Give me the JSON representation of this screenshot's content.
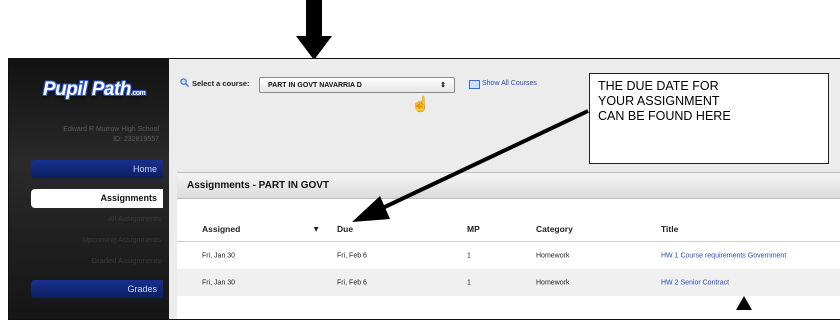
{
  "sidebar": {
    "logo_text": "Pupil Path",
    "logo_suffix": ".com",
    "school_name": "Edward R Murrow High School",
    "school_id": "ID: 232819557",
    "nav": {
      "home": "Home",
      "assignments": "Assignments",
      "all_assignments": "All Assignments",
      "upcoming_assignments": "Upcoming Assignments",
      "graded_assignments": "Graded Assignments",
      "grades": "Grades"
    }
  },
  "course_selector": {
    "label": "Select a course:",
    "selected": "PART IN GOVT NAVARRIA D",
    "show_all": "Show All Courses"
  },
  "panel": {
    "title": "Assignments - PART IN GOVT",
    "columns": {
      "assigned": "Assigned",
      "due": "Due",
      "mp": "MP",
      "category": "Category",
      "title": "Title"
    },
    "rows": [
      {
        "assigned": "Fri, Jan 30",
        "due": "Fri, Feb 6",
        "mp": "1",
        "category": "Homework",
        "title": "HW 1 Course requirements Government"
      },
      {
        "assigned": "Fri, Jan 30",
        "due": "Fri, Feb 6",
        "mp": "1",
        "category": "Homework",
        "title": "HW 2 Senior Contract"
      }
    ]
  },
  "annotation": {
    "lines": [
      "THE DUE DATE FOR",
      "YOUR ASSIGNMENT",
      "CAN BE FOUND HERE"
    ]
  },
  "colors": {
    "nav_blue": "#16318e",
    "link_blue": "#2a4bb0",
    "sidebar_black": "#111111"
  }
}
